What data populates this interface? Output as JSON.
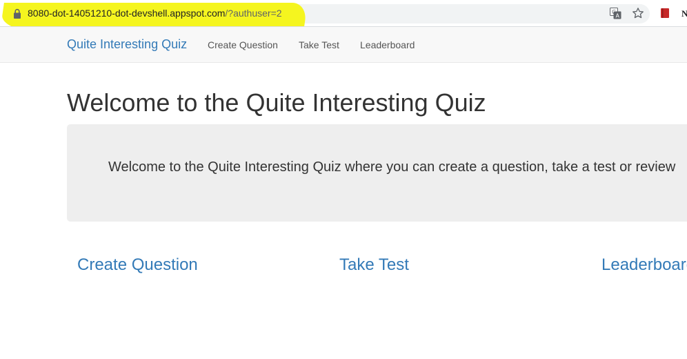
{
  "browser": {
    "url_host": "8080-dot-14051210-dot-devshell.appspot.com",
    "url_path": "/?authuser=2",
    "extension_label": "N",
    "highlight_color": "#f5f51f"
  },
  "navbar": {
    "brand": "Quite Interesting Quiz",
    "links": [
      {
        "label": "Create Question"
      },
      {
        "label": "Take Test"
      },
      {
        "label": "Leaderboard"
      }
    ]
  },
  "main": {
    "title": "Welcome to the Quite Interesting Quiz",
    "intro": "Welcome to the Quite Interesting Quiz where you can create a question, take a test or review",
    "actions": [
      {
        "label": "Create Question"
      },
      {
        "label": "Take Test"
      },
      {
        "label": "Leaderboard"
      }
    ]
  },
  "colors": {
    "link": "#337ab7",
    "navbar_bg": "#f8f8f8",
    "jumbotron_bg": "#eeeeee"
  }
}
